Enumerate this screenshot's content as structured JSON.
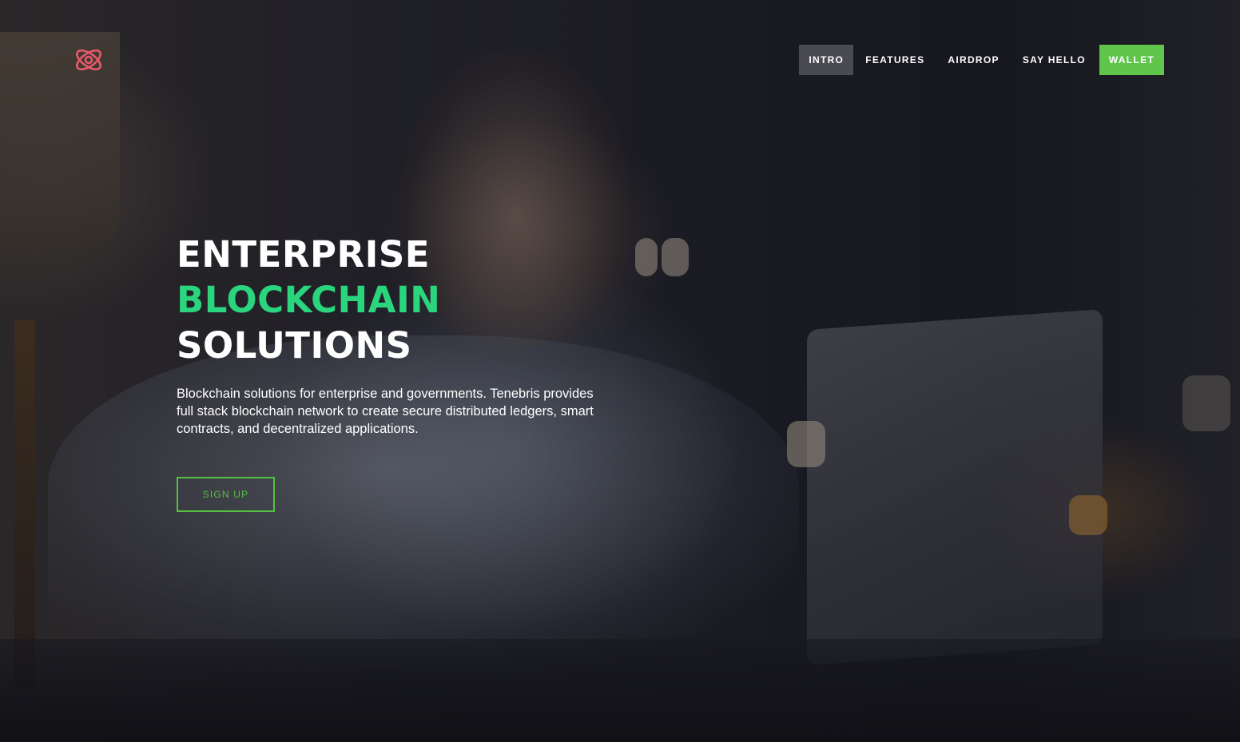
{
  "brand": {
    "logo_icon": "atom-icon",
    "accent_color": "#e8596b"
  },
  "nav": {
    "items": [
      {
        "label": "INTRO",
        "active": true
      },
      {
        "label": "FEATURES",
        "active": false
      },
      {
        "label": "AIRDROP",
        "active": false
      },
      {
        "label": "SAY HELLO",
        "active": false
      }
    ],
    "wallet_label": "WALLET",
    "active_bg": "#4a4a52",
    "wallet_bg": "#5fc54b"
  },
  "hero": {
    "headline_line1": "ENTERPRISE",
    "headline_line2": "BLOCKCHAIN",
    "headline_line3": "SOLUTIONS",
    "headline_accent_color": "#2ad57e",
    "description": "Blockchain solutions for enterprise and governments. Tenebris provides full stack blockchain network to create secure distributed ledgers, smart contracts, and decentralized applications.",
    "cta_label": "SIGN UP",
    "cta_color": "#56c13f"
  }
}
